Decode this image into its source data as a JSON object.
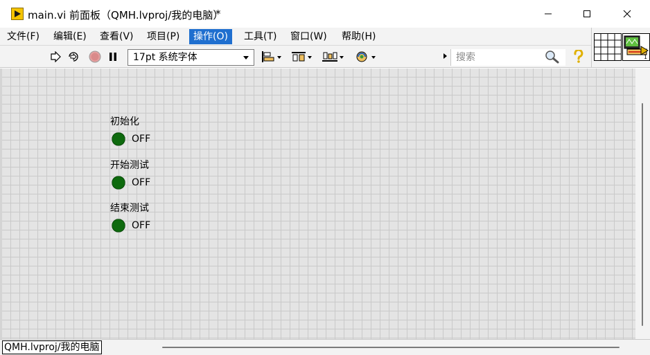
{
  "window": {
    "title": "main.vi 前面板（QMH.lvproj/我的电脑）",
    "modified_marker": "*"
  },
  "menu": {
    "items": [
      {
        "label": "文件(F)"
      },
      {
        "label": "编辑(E)"
      },
      {
        "label": "查看(V)"
      },
      {
        "label": "项目(P)"
      },
      {
        "label": "操作(O)",
        "active": true
      },
      {
        "label": "工具(T)"
      },
      {
        "label": "窗口(W)"
      },
      {
        "label": "帮助(H)"
      }
    ]
  },
  "toolbar": {
    "font_select": "17pt 系统字体",
    "search_placeholder": "搜索",
    "icons": [
      "run-icon",
      "run-continuously-icon",
      "abort-icon",
      "pause-icon",
      "align-icon",
      "distribute-icon",
      "resize-icon",
      "reorder-icon",
      "search-icon",
      "help-icon"
    ]
  },
  "front_panel": {
    "indicators": [
      {
        "label": "初始化",
        "state": "OFF"
      },
      {
        "label": "开始测试",
        "state": "OFF"
      },
      {
        "label": "结束测试",
        "state": "OFF"
      }
    ]
  },
  "status": {
    "context": "QMH.lvproj/我的电脑"
  },
  "colors": {
    "led_off": "#0e6a0e",
    "menu_active": "#1f6fcf",
    "canvas": "#e4e4e4",
    "grid_line": "#c9c9c9"
  }
}
